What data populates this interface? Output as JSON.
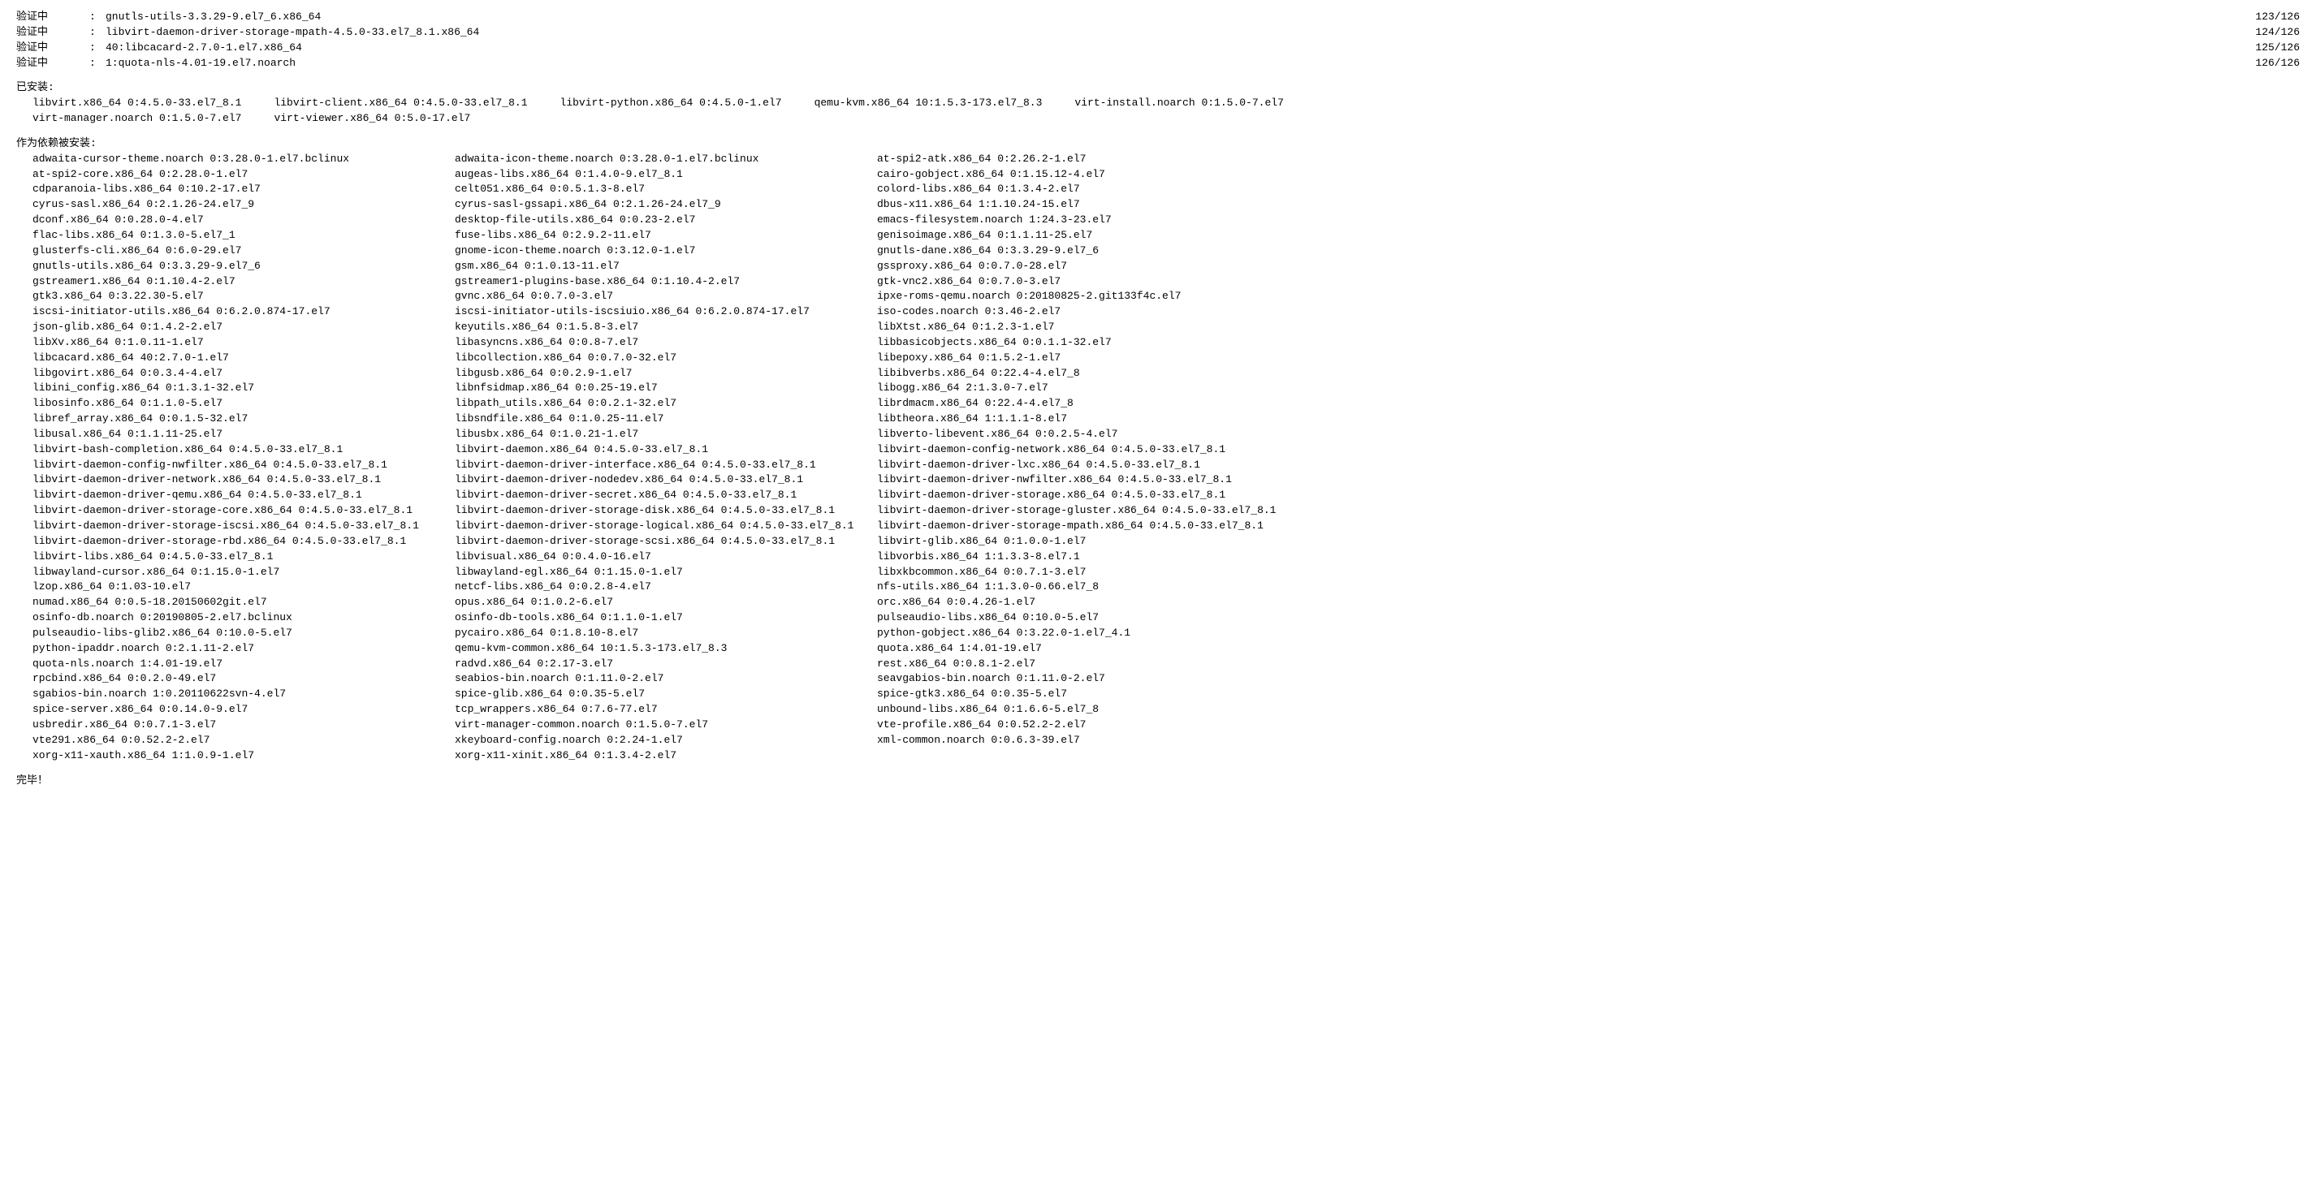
{
  "labels": {
    "verifying": "验证中",
    "colon": ":",
    "installed_header": "已安装:",
    "dep_installed_header": "作为依赖被安装:",
    "done": "完毕！"
  },
  "verify": [
    {
      "pkg": "gnutls-utils-3.3.29-9.el7_6.x86_64",
      "count": "123/126"
    },
    {
      "pkg": "libvirt-daemon-driver-storage-mpath-4.5.0-33.el7_8.1.x86_64",
      "count": "124/126"
    },
    {
      "pkg": "40:libcacard-2.7.0-1.el7.x86_64",
      "count": "125/126"
    },
    {
      "pkg": "1:quota-nls-4.01-19.el7.noarch",
      "count": "126/126"
    }
  ],
  "installed": [
    [
      "libvirt.x86_64 0:4.5.0-33.el7_8.1",
      "libvirt-client.x86_64 0:4.5.0-33.el7_8.1",
      "libvirt-python.x86_64 0:4.5.0-1.el7",
      "qemu-kvm.x86_64 10:1.5.3-173.el7_8.3",
      "virt-install.noarch 0:1.5.0-7.el7"
    ],
    [
      "virt-manager.noarch 0:1.5.0-7.el7",
      "virt-viewer.x86_64 0:5.0-17.el7"
    ]
  ],
  "deps": [
    [
      "adwaita-cursor-theme.noarch 0:3.28.0-1.el7.bclinux",
      "adwaita-icon-theme.noarch 0:3.28.0-1.el7.bclinux",
      "at-spi2-atk.x86_64 0:2.26.2-1.el7"
    ],
    [
      "at-spi2-core.x86_64 0:2.28.0-1.el7",
      "augeas-libs.x86_64 0:1.4.0-9.el7_8.1",
      "cairo-gobject.x86_64 0:1.15.12-4.el7"
    ],
    [
      "cdparanoia-libs.x86_64 0:10.2-17.el7",
      "celt051.x86_64 0:0.5.1.3-8.el7",
      "colord-libs.x86_64 0:1.3.4-2.el7"
    ],
    [
      "cyrus-sasl.x86_64 0:2.1.26-24.el7_9",
      "cyrus-sasl-gssapi.x86_64 0:2.1.26-24.el7_9",
      "dbus-x11.x86_64 1:1.10.24-15.el7"
    ],
    [
      "dconf.x86_64 0:0.28.0-4.el7",
      "desktop-file-utils.x86_64 0:0.23-2.el7",
      "emacs-filesystem.noarch 1:24.3-23.el7"
    ],
    [
      "flac-libs.x86_64 0:1.3.0-5.el7_1",
      "fuse-libs.x86_64 0:2.9.2-11.el7",
      "genisoimage.x86_64 0:1.1.11-25.el7"
    ],
    [
      "glusterfs-cli.x86_64 0:6.0-29.el7",
      "gnome-icon-theme.noarch 0:3.12.0-1.el7",
      "gnutls-dane.x86_64 0:3.3.29-9.el7_6"
    ],
    [
      "gnutls-utils.x86_64 0:3.3.29-9.el7_6",
      "gsm.x86_64 0:1.0.13-11.el7",
      "gssproxy.x86_64 0:0.7.0-28.el7"
    ],
    [
      "gstreamer1.x86_64 0:1.10.4-2.el7",
      "gstreamer1-plugins-base.x86_64 0:1.10.4-2.el7",
      "gtk-vnc2.x86_64 0:0.7.0-3.el7"
    ],
    [
      "gtk3.x86_64 0:3.22.30-5.el7",
      "gvnc.x86_64 0:0.7.0-3.el7",
      "ipxe-roms-qemu.noarch 0:20180825-2.git133f4c.el7"
    ],
    [
      "iscsi-initiator-utils.x86_64 0:6.2.0.874-17.el7",
      "iscsi-initiator-utils-iscsiuio.x86_64 0:6.2.0.874-17.el7",
      "iso-codes.noarch 0:3.46-2.el7"
    ],
    [
      "json-glib.x86_64 0:1.4.2-2.el7",
      "keyutils.x86_64 0:1.5.8-3.el7",
      "libXtst.x86_64 0:1.2.3-1.el7"
    ],
    [
      "libXv.x86_64 0:1.0.11-1.el7",
      "libasyncns.x86_64 0:0.8-7.el7",
      "libbasicobjects.x86_64 0:0.1.1-32.el7"
    ],
    [
      "libcacard.x86_64 40:2.7.0-1.el7",
      "libcollection.x86_64 0:0.7.0-32.el7",
      "libepoxy.x86_64 0:1.5.2-1.el7"
    ],
    [
      "libgovirt.x86_64 0:0.3.4-4.el7",
      "libgusb.x86_64 0:0.2.9-1.el7",
      "libibverbs.x86_64 0:22.4-4.el7_8"
    ],
    [
      "libini_config.x86_64 0:1.3.1-32.el7",
      "libnfsidmap.x86_64 0:0.25-19.el7",
      "libogg.x86_64 2:1.3.0-7.el7"
    ],
    [
      "libosinfo.x86_64 0:1.1.0-5.el7",
      "libpath_utils.x86_64 0:0.2.1-32.el7",
      "librdmacm.x86_64 0:22.4-4.el7_8"
    ],
    [
      "libref_array.x86_64 0:0.1.5-32.el7",
      "libsndfile.x86_64 0:1.0.25-11.el7",
      "libtheora.x86_64 1:1.1.1-8.el7"
    ],
    [
      "libusal.x86_64 0:1.1.11-25.el7",
      "libusbx.x86_64 0:1.0.21-1.el7",
      "libverto-libevent.x86_64 0:0.2.5-4.el7"
    ],
    [
      "libvirt-bash-completion.x86_64 0:4.5.0-33.el7_8.1",
      "libvirt-daemon.x86_64 0:4.5.0-33.el7_8.1",
      "libvirt-daemon-config-network.x86_64 0:4.5.0-33.el7_8.1"
    ],
    [
      "libvirt-daemon-config-nwfilter.x86_64 0:4.5.0-33.el7_8.1",
      "libvirt-daemon-driver-interface.x86_64 0:4.5.0-33.el7_8.1",
      "libvirt-daemon-driver-lxc.x86_64 0:4.5.0-33.el7_8.1"
    ],
    [
      "libvirt-daemon-driver-network.x86_64 0:4.5.0-33.el7_8.1",
      "libvirt-daemon-driver-nodedev.x86_64 0:4.5.0-33.el7_8.1",
      "libvirt-daemon-driver-nwfilter.x86_64 0:4.5.0-33.el7_8.1"
    ],
    [
      "libvirt-daemon-driver-qemu.x86_64 0:4.5.0-33.el7_8.1",
      "libvirt-daemon-driver-secret.x86_64 0:4.5.0-33.el7_8.1",
      "libvirt-daemon-driver-storage.x86_64 0:4.5.0-33.el7_8.1"
    ],
    [
      "libvirt-daemon-driver-storage-core.x86_64 0:4.5.0-33.el7_8.1",
      "libvirt-daemon-driver-storage-disk.x86_64 0:4.5.0-33.el7_8.1",
      "libvirt-daemon-driver-storage-gluster.x86_64 0:4.5.0-33.el7_8.1"
    ],
    [
      "libvirt-daemon-driver-storage-iscsi.x86_64 0:4.5.0-33.el7_8.1",
      "libvirt-daemon-driver-storage-logical.x86_64 0:4.5.0-33.el7_8.1",
      "libvirt-daemon-driver-storage-mpath.x86_64 0:4.5.0-33.el7_8.1"
    ],
    [
      "libvirt-daemon-driver-storage-rbd.x86_64 0:4.5.0-33.el7_8.1",
      "libvirt-daemon-driver-storage-scsi.x86_64 0:4.5.0-33.el7_8.1",
      "libvirt-glib.x86_64 0:1.0.0-1.el7"
    ],
    [
      "libvirt-libs.x86_64 0:4.5.0-33.el7_8.1",
      "libvisual.x86_64 0:0.4.0-16.el7",
      "libvorbis.x86_64 1:1.3.3-8.el7.1"
    ],
    [
      "libwayland-cursor.x86_64 0:1.15.0-1.el7",
      "libwayland-egl.x86_64 0:1.15.0-1.el7",
      "libxkbcommon.x86_64 0:0.7.1-3.el7"
    ],
    [
      "lzop.x86_64 0:1.03-10.el7",
      "netcf-libs.x86_64 0:0.2.8-4.el7",
      "nfs-utils.x86_64 1:1.3.0-0.66.el7_8"
    ],
    [
      "numad.x86_64 0:0.5-18.20150602git.el7",
      "opus.x86_64 0:1.0.2-6.el7",
      "orc.x86_64 0:0.4.26-1.el7"
    ],
    [
      "osinfo-db.noarch 0:20190805-2.el7.bclinux",
      "osinfo-db-tools.x86_64 0:1.1.0-1.el7",
      "pulseaudio-libs.x86_64 0:10.0-5.el7"
    ],
    [
      "pulseaudio-libs-glib2.x86_64 0:10.0-5.el7",
      "pycairo.x86_64 0:1.8.10-8.el7",
      "python-gobject.x86_64 0:3.22.0-1.el7_4.1"
    ],
    [
      "python-ipaddr.noarch 0:2.1.11-2.el7",
      "qemu-kvm-common.x86_64 10:1.5.3-173.el7_8.3",
      "quota.x86_64 1:4.01-19.el7"
    ],
    [
      "quota-nls.noarch 1:4.01-19.el7",
      "radvd.x86_64 0:2.17-3.el7",
      "rest.x86_64 0:0.8.1-2.el7"
    ],
    [
      "rpcbind.x86_64 0:0.2.0-49.el7",
      "seabios-bin.noarch 0:1.11.0-2.el7",
      "seavgabios-bin.noarch 0:1.11.0-2.el7"
    ],
    [
      "sgabios-bin.noarch 1:0.20110622svn-4.el7",
      "spice-glib.x86_64 0:0.35-5.el7",
      "spice-gtk3.x86_64 0:0.35-5.el7"
    ],
    [
      "spice-server.x86_64 0:0.14.0-9.el7",
      "tcp_wrappers.x86_64 0:7.6-77.el7",
      "unbound-libs.x86_64 0:1.6.6-5.el7_8"
    ],
    [
      "usbredir.x86_64 0:0.7.1-3.el7",
      "virt-manager-common.noarch 0:1.5.0-7.el7",
      "vte-profile.x86_64 0:0.52.2-2.el7"
    ],
    [
      "vte291.x86_64 0:0.52.2-2.el7",
      "xkeyboard-config.noarch 0:2.24-1.el7",
      "xml-common.noarch 0:0.6.3-39.el7"
    ],
    [
      "xorg-x11-xauth.x86_64 1:1.0.9-1.el7",
      "xorg-x11-xinit.x86_64 0:1.3.4-2.el7",
      ""
    ]
  ]
}
